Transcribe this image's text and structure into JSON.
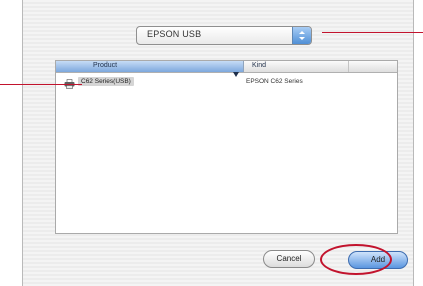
{
  "connection_popup": {
    "selected": "EPSON USB",
    "icon": "chevron-updown-icon"
  },
  "printer_list": {
    "columns": [
      {
        "label": "Product"
      },
      {
        "label": "Kind"
      }
    ],
    "sort_icon": "sort-ascending-icon",
    "rows": [
      {
        "icon": "printer-icon",
        "product": "C62 Series(USB)",
        "kind": "EPSON C62 Series"
      }
    ]
  },
  "buttons": {
    "cancel_label": "Cancel",
    "add_label": "Add"
  },
  "annotations": {
    "color": "#c2132d"
  }
}
